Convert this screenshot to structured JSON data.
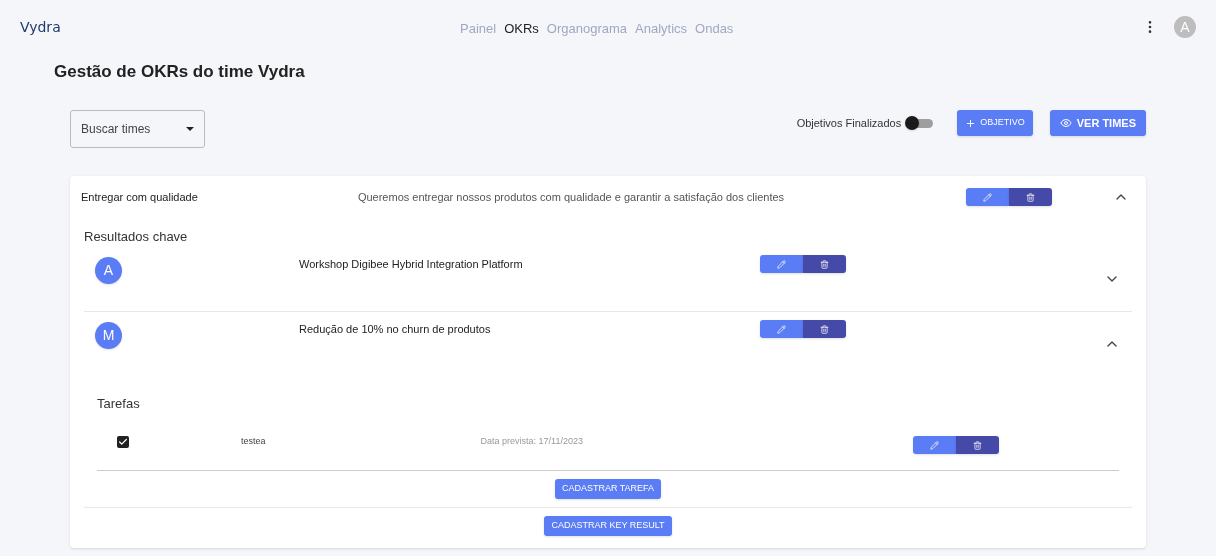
{
  "brand": "Vydra",
  "nav": [
    {
      "label": "Painel",
      "selected": false
    },
    {
      "label": "OKRs",
      "selected": true
    },
    {
      "label": "Organograma",
      "selected": false
    },
    {
      "label": "Analytics",
      "selected": false
    },
    {
      "label": "Ondas",
      "selected": false
    }
  ],
  "user_initial": "A",
  "page_title": "Gestão de OKRs do time Vydra",
  "team_select": {
    "placeholder": "Buscar times"
  },
  "finished_toggle": {
    "label": "Objetivos Finalizados",
    "on": false
  },
  "buttons": {
    "new_objective": "OBJETIVO",
    "view_teams": "VER TIMES"
  },
  "objective": {
    "title": "Entregar com qualidade",
    "description": "Queremos entregar nossos produtos com qualidade e garantir a satisfação dos clientes",
    "expanded": true,
    "key_results_heading": "Resultados chave",
    "key_results": [
      {
        "initial": "A",
        "title": "Workshop Digibee Hybrid Integration Platform",
        "expanded": false
      },
      {
        "initial": "M",
        "title": "Redução de 10% no churn de produtos",
        "expanded": true,
        "tasks_heading": "Tarefas",
        "tasks": [
          {
            "name": "testea",
            "due": "Data prevista: 17/11/2023",
            "checked": true
          }
        ],
        "add_task": "CADASTRAR TAREFA"
      }
    ],
    "add_key_result": "CADASTRAR KEY RESULT"
  }
}
